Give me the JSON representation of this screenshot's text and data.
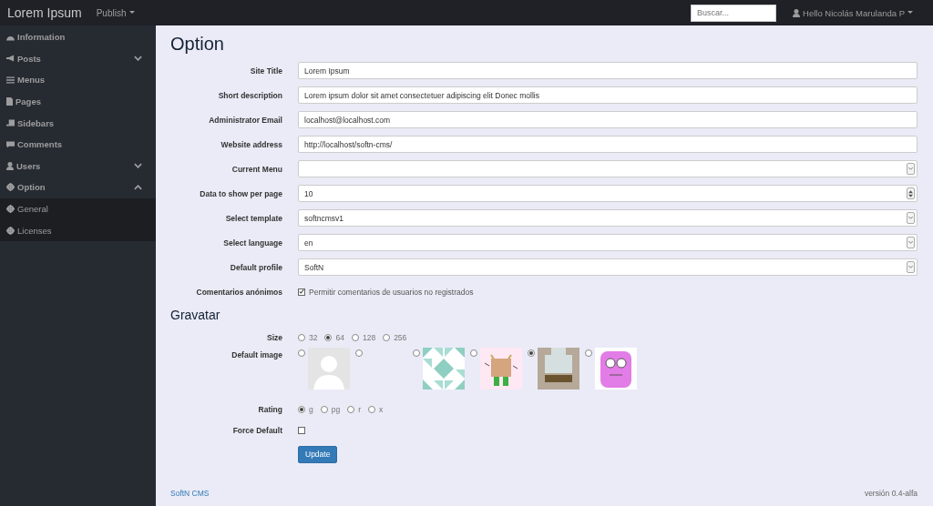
{
  "navbar": {
    "brand": "Lorem Ipsum",
    "menu": "Publish",
    "search": {
      "placeholder": "Buscar..."
    },
    "user": "Hello Nicolás Marulanda P"
  },
  "sidebar": {
    "items": [
      {
        "label": "Information"
      },
      {
        "label": "Posts",
        "expanded": false
      },
      {
        "label": "Menus"
      },
      {
        "label": "Pages"
      },
      {
        "label": "Sidebars"
      },
      {
        "label": "Comments"
      },
      {
        "label": "Users",
        "expanded": false
      },
      {
        "label": "Option",
        "expanded": true,
        "children": [
          {
            "label": "General"
          },
          {
            "label": "Licenses"
          }
        ]
      }
    ]
  },
  "title": "Option",
  "fields": [
    {
      "label": "Site Title",
      "kind": "text",
      "value": "Lorem Ipsum"
    },
    {
      "label": "Short description",
      "kind": "text",
      "value": "Lorem ipsum dolor sit amet consectetuer adipiscing elit Donec mollis"
    },
    {
      "label": "Administrator Email",
      "kind": "text",
      "value": "localhost@localhost.com"
    },
    {
      "label": "Website address",
      "kind": "text",
      "value": "http://localhost/softn-cms/"
    },
    {
      "label": "Current Menu",
      "kind": "select"
    },
    {
      "label": "Data to show per page",
      "kind": "number",
      "value": "10"
    },
    {
      "label": "Select template",
      "kind": "select",
      "value": "softncmsv1"
    },
    {
      "label": "Select language",
      "kind": "select",
      "value": "en"
    },
    {
      "label": "Default profile",
      "kind": "select",
      "value": "SoftN"
    },
    {
      "label": "Comentarios anónimos",
      "kind": "checkbox",
      "checked": true,
      "text": "Permitir comentarios de usuarios no registrados"
    }
  ],
  "gravatar": {
    "title": "Gravatar",
    "size": {
      "label": "Size",
      "options": [
        {
          "label": "32",
          "selected": false
        },
        {
          "label": "64",
          "selected": true
        },
        {
          "label": "128",
          "selected": false
        },
        {
          "label": "256",
          "selected": false
        }
      ]
    },
    "default_image": {
      "label": "Default image",
      "options": [
        {
          "kind": "mystery",
          "selected": false
        },
        {
          "kind": "blank",
          "selected": false
        },
        {
          "kind": "identicon",
          "selected": false
        },
        {
          "kind": "monster",
          "selected": false
        },
        {
          "kind": "retro",
          "selected": true
        },
        {
          "kind": "face",
          "selected": false
        }
      ]
    },
    "rating": {
      "label": "Rating",
      "options": [
        {
          "label": "g",
          "selected": true
        },
        {
          "label": "pg",
          "selected": false
        },
        {
          "label": "r",
          "selected": false
        },
        {
          "label": "x",
          "selected": false
        }
      ]
    },
    "force_default": {
      "label": "Force Default",
      "checked": false
    }
  },
  "button": "Update",
  "footer": {
    "link": "SoftN CMS",
    "version": "versión 0.4-alfa"
  }
}
